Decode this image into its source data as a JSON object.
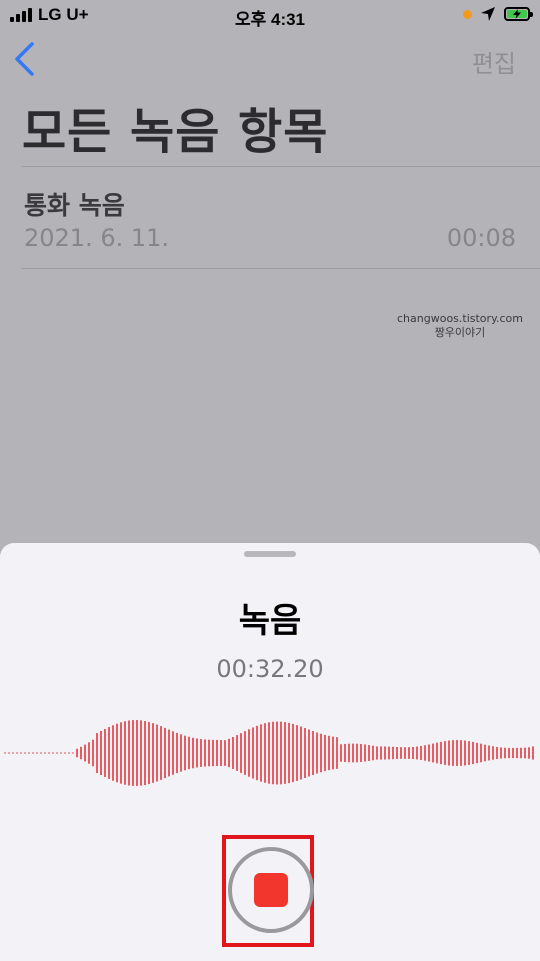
{
  "status_bar": {
    "carrier": "LG U+",
    "time": "오후 4:31"
  },
  "nav": {
    "back_icon": "chevron-left-icon",
    "edit_label": "편집",
    "title": "모든 녹음 항목"
  },
  "recordings": [
    {
      "title": "통화 녹음",
      "date": "2021. 6. 11.",
      "duration": "00:08"
    }
  ],
  "watermark": {
    "line1": "changwoos.tistory.com",
    "line2": "짱우이야기"
  },
  "sheet": {
    "title": "녹음",
    "timer": "00:32.20",
    "stop_icon": "stop-icon"
  },
  "colors": {
    "accent_blue": "#3478f6",
    "waveform_red": "#e0383e",
    "stop_red": "#f2362e",
    "highlight_red": "#e1161c",
    "battery_green": "#3fc84a"
  }
}
